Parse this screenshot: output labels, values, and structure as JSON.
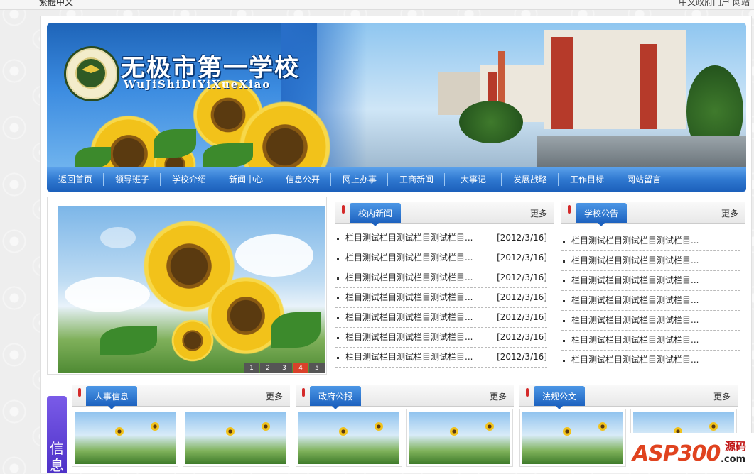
{
  "topbar": {
    "left_text": "繁體中文",
    "right_text": "中文政府门户 网站"
  },
  "header": {
    "school_name_cn": "无极市第一学校",
    "school_name_pinyin": "WuJiShiDiYiXueXiao",
    "seal_text": "UNIVERSITY"
  },
  "nav": {
    "items": [
      "返回首页",
      "领导班子",
      "学校介绍",
      "新闻中心",
      "信息公开",
      "网上办事",
      "工商新闻",
      "大事记",
      "发展战略",
      "工作目标",
      "网站留言"
    ]
  },
  "slider": {
    "pages": [
      "1",
      "2",
      "3",
      "4",
      "5"
    ],
    "active_page": 4
  },
  "school_news": {
    "title": "校内新闻",
    "more": "更多",
    "items": [
      {
        "text": "栏目测试栏目测试栏目测试栏目...",
        "date": "[2012/3/16]"
      },
      {
        "text": "栏目测试栏目测试栏目测试栏目...",
        "date": "[2012/3/16]"
      },
      {
        "text": "栏目测试栏目测试栏目测试栏目...",
        "date": "[2012/3/16]"
      },
      {
        "text": "栏目测试栏目测试栏目测试栏目...",
        "date": "[2012/3/16]"
      },
      {
        "text": "栏目测试栏目测试栏目测试栏目...",
        "date": "[2012/3/16]"
      },
      {
        "text": "栏目测试栏目测试栏目测试栏目...",
        "date": "[2012/3/16]"
      },
      {
        "text": "栏目测试栏目测试栏目测试栏目...",
        "date": "[2012/3/16]"
      }
    ]
  },
  "school_notice": {
    "title": "学校公告",
    "more": "更多",
    "items": [
      "栏目测试栏目测试栏目测试栏目...",
      "栏目测试栏目测试栏目测试栏目...",
      "栏目测试栏目测试栏目测试栏目...",
      "栏目测试栏目测试栏目测试栏目...",
      "栏目测试栏目测试栏目测试栏目...",
      "栏目测试栏目测试栏目测试栏目...",
      "栏目测试栏目测试栏目测试栏目..."
    ]
  },
  "side_tag": {
    "chars": [
      "信",
      "息"
    ]
  },
  "bottom_panels": [
    {
      "title": "人事信息",
      "more": "更多"
    },
    {
      "title": "政府公报",
      "more": "更多"
    },
    {
      "title": "法规公文",
      "more": "更多"
    }
  ],
  "watermark": {
    "main": "ASP300",
    "cn": "源码",
    "domain": ".com"
  }
}
